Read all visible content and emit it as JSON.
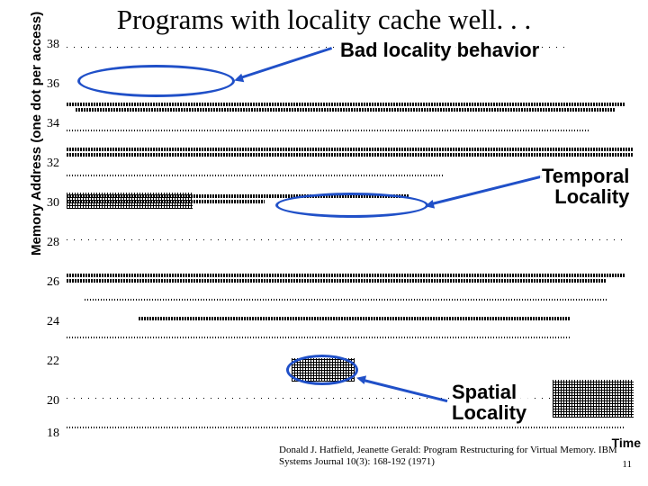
{
  "title": "Programs with locality cache well. . .",
  "y_axis_label": "Memory Address (one dot per access)",
  "y_ticks": [
    "38",
    "36",
    "34",
    "32",
    "30",
    "28",
    "26",
    "24",
    "22",
    "20",
    "18"
  ],
  "annotations": {
    "bad": "Bad locality behavior",
    "temporal_l1": "Temporal",
    "temporal_l2": "Locality",
    "spatial_l1": "Spatial",
    "spatial_l2": "Locality"
  },
  "x_axis_label": "Time",
  "citation": "Donald J. Hatfield, Jeanette Gerald: Program Restructuring for Virtual Memory. IBM Systems Journal 10(3): 168-192 (1971)",
  "page_number": "11",
  "chart_data": {
    "type": "scatter",
    "title": "Programs with locality cache well",
    "xlabel": "Time",
    "ylabel": "Memory Address (one dot per access)",
    "ylim": [
      18,
      38
    ],
    "description": "Memory reference trace showing time on x-axis and page address on y-axis; dots cluster in horizontal bands (temporal locality) and vertical/diagonal blocks (spatial locality).",
    "annotations": [
      {
        "label": "Bad locality behavior",
        "y_approx": 36,
        "x_range": [
          0.05,
          0.28
        ]
      },
      {
        "label": "Temporal Locality",
        "y_approx": 30,
        "x_range": [
          0.38,
          0.62
        ]
      },
      {
        "label": "Spatial Locality",
        "y_approx": 22,
        "x_range": [
          0.42,
          0.52
        ]
      }
    ]
  }
}
